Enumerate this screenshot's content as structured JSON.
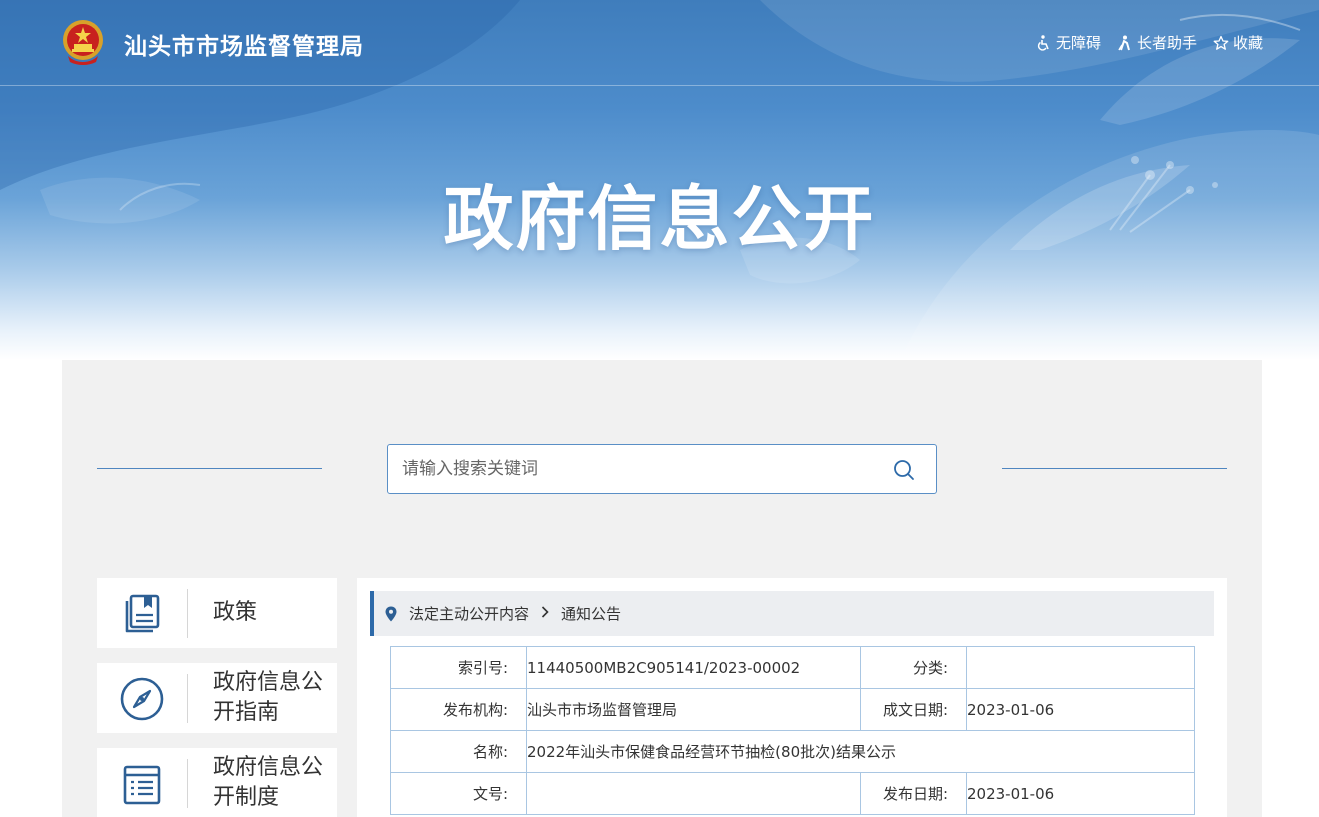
{
  "header": {
    "site_name": "汕头市市场监督管理局",
    "tools": [
      {
        "icon": "accessibility-icon",
        "label": "无障碍"
      },
      {
        "icon": "elder-assist-icon",
        "label": "长者助手"
      },
      {
        "icon": "star-icon",
        "label": "收藏"
      }
    ]
  },
  "hero": {
    "title": "政府信息公开"
  },
  "search": {
    "placeholder": "请输入搜索关键词"
  },
  "nav": [
    {
      "icon": "policy-book-icon",
      "label": "政策"
    },
    {
      "icon": "compass-icon",
      "label": "政府信息公开指南"
    },
    {
      "icon": "document-list-icon",
      "label": "政府信息公开制度"
    }
  ],
  "breadcrumb": {
    "items": [
      "法定主动公开内容",
      "通知公告"
    ]
  },
  "info_table": {
    "index_label": "索引号:",
    "index_value": "11440500MB2C905141/2023-00002",
    "category_label": "分类:",
    "category_value": "",
    "publisher_label": "发布机构:",
    "publisher_value": "汕头市市场监督管理局",
    "written_date_label": "成文日期:",
    "written_date_value": "2023-01-06",
    "name_label": "名称:",
    "name_value": "2022年汕头市保健食品经营环节抽检(80批次)结果公示",
    "doc_no_label": "文号:",
    "doc_no_value": "",
    "publish_date_label": "发布日期:",
    "publish_date_value": "2023-01-06"
  },
  "colors": {
    "banner_blue": "#4d8ccb",
    "accent_blue": "#2d6aa9",
    "panel_gray": "#f1f1f1",
    "table_border": "#a9c6e2"
  }
}
